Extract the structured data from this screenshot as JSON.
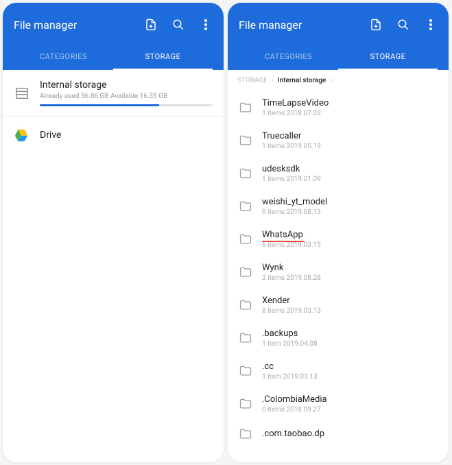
{
  "left": {
    "title": "File manager",
    "tabs": {
      "categories": "CATEGORIES",
      "storage": "STORAGE"
    },
    "storage": {
      "name": "Internal storage",
      "meta": "Already used 36.86 GB  Available 16.35 GB",
      "used_percent": 69
    },
    "drive": {
      "name": "Drive"
    }
  },
  "right": {
    "title": "File manager",
    "tabs": {
      "categories": "CATEGORIES",
      "storage": "STORAGE"
    },
    "breadcrumb": {
      "root": "STORAGE",
      "current": "Internal storage"
    },
    "folders": [
      {
        "name": "TimeLapseVideo",
        "meta": "1 items  2018.07.03",
        "highlight": false
      },
      {
        "name": "Truecaller",
        "meta": "1 items  2019.05.19",
        "highlight": false
      },
      {
        "name": "udesksdk",
        "meta": "1 items  2019.01.09",
        "highlight": false
      },
      {
        "name": "weishi_yt_model",
        "meta": "0 items  2019.08.13",
        "highlight": false
      },
      {
        "name": "WhatsApp",
        "meta": "6 items  2019.03.15",
        "highlight": true
      },
      {
        "name": "Wynk",
        "meta": "2 items  2019.08.28",
        "highlight": false
      },
      {
        "name": "Xender",
        "meta": "8 items  2019.03.13",
        "highlight": false
      },
      {
        "name": ".backups",
        "meta": "1 item  2019.04.08",
        "highlight": false
      },
      {
        "name": ".cc",
        "meta": "1 item  2019.03.13",
        "highlight": false
      },
      {
        "name": ".ColombiaMedia",
        "meta": "0 items  2018.09.27",
        "highlight": false
      },
      {
        "name": ".com.taobao.dp",
        "meta": "",
        "highlight": false
      }
    ]
  }
}
